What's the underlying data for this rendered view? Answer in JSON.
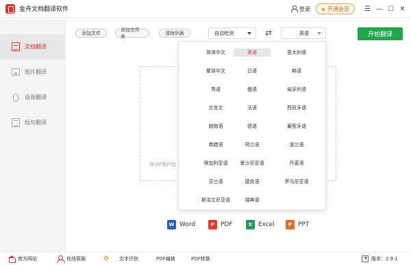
{
  "app": {
    "title": "金舟文档翻译软件"
  },
  "titlebar": {
    "login_label": "登录",
    "vip_label": "开通会员"
  },
  "sidebar": {
    "items": [
      {
        "label": "文档翻译"
      },
      {
        "label": "图片翻译"
      },
      {
        "label": "语音翻译"
      },
      {
        "label": "短句翻译"
      }
    ]
  },
  "toolbar": {
    "add_file": "添加文件",
    "add_folder": "添加文件夹",
    "clear_list": "清除列表",
    "source_lang": "自动检测",
    "target_lang": "英语",
    "start": "开始翻译"
  },
  "dropzone": {
    "hint_left": "非VIP用户仅",
    "hint_right": ")"
  },
  "languages": [
    "简体中文",
    "英语",
    "意大利语",
    "繁体中文",
    "日语",
    "韩语",
    "粤语",
    "俄语",
    "匈牙利语",
    "文言文",
    "法语",
    "西班牙语",
    "越南语",
    "德语",
    "葡萄牙语",
    "希腊语",
    "荷兰语",
    "波兰语",
    "保加利亚语",
    "爱沙尼亚语",
    "丹麦语",
    "芬兰语",
    "捷克语",
    "罗马尼亚语",
    "斯洛文尼亚语",
    "瑞典语"
  ],
  "selected_language": "英语",
  "formats": [
    {
      "label": "Word",
      "icon": "W",
      "color": "#2b5fb7"
    },
    {
      "label": "PDF",
      "icon": "P",
      "color": "#e03a2e"
    },
    {
      "label": "Excel",
      "icon": "X",
      "color": "#1f9e5a"
    },
    {
      "label": "PPT",
      "icon": "P",
      "color": "#e86a2a"
    }
  ],
  "statusbar": {
    "website": "官方网站",
    "service": "在线客服",
    "ocr": "文字识别",
    "pdf_edit": "PDF编辑",
    "pdf_convert": "PDF转换",
    "version": "版本：2.9.1"
  }
}
